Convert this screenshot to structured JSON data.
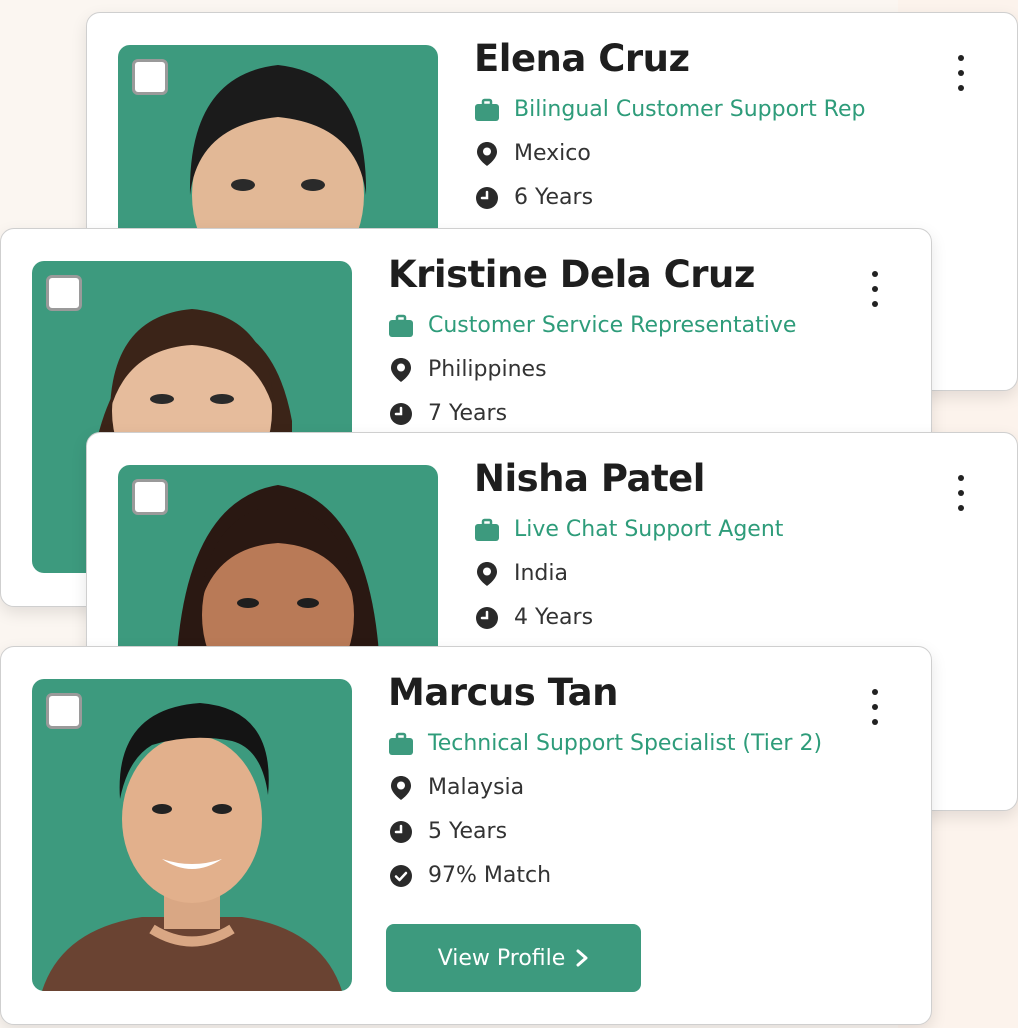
{
  "colors": {
    "accent": "#3d9a7e",
    "role_text": "#2e9c7a",
    "page_bg": "#fbf6f1"
  },
  "cards": [
    {
      "name": "Elena Cruz",
      "role": "Bilingual Customer Support Rep",
      "location": "Mexico",
      "experience": "6 Years",
      "icons": [
        "briefcase-icon",
        "location-pin-icon",
        "clock-icon"
      ]
    },
    {
      "name": "Kristine Dela Cruz",
      "role": "Customer Service Representative",
      "location": "Philippines",
      "experience": "7 Years",
      "icons": [
        "briefcase-icon",
        "location-pin-icon",
        "clock-icon"
      ]
    },
    {
      "name": "Nisha Patel",
      "role": "Live Chat Support Agent",
      "location": "India",
      "experience": "4 Years",
      "icons": [
        "briefcase-icon",
        "location-pin-icon",
        "clock-icon"
      ]
    },
    {
      "name": "Marcus Tan",
      "role": "Technical Support Specialist (Tier 2)",
      "location": "Malaysia",
      "experience": "5 Years",
      "match": "97% Match",
      "button_label": "View Profile",
      "icons": [
        "briefcase-icon",
        "location-pin-icon",
        "clock-icon",
        "check-circle-icon",
        "chevron-right-icon"
      ]
    }
  ]
}
